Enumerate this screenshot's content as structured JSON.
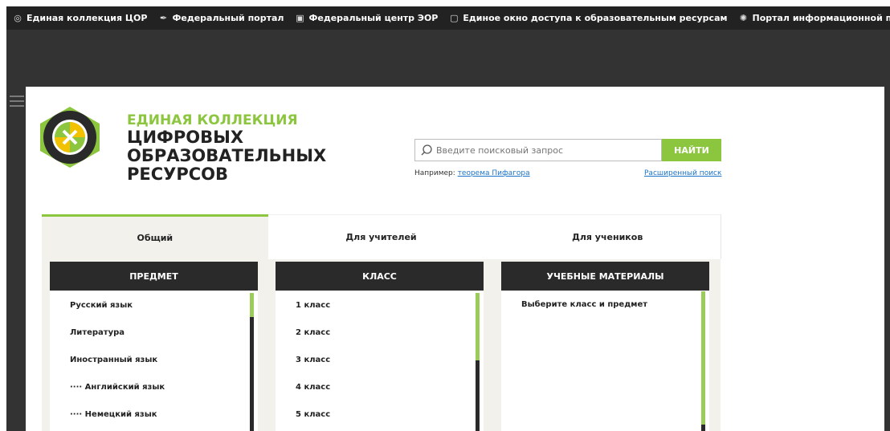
{
  "topnav": [
    {
      "label": "Единая коллекция ЦОР",
      "icon": "collection-icon"
    },
    {
      "label": "Федеральный портал",
      "icon": "feather-icon"
    },
    {
      "label": "Федеральный центр ЭОР",
      "icon": "book-icon"
    },
    {
      "label": "Единое окно доступа к образовательным ресурсам",
      "icon": "window-icon"
    },
    {
      "label": "Портал информационной поддержки ЕГЭ",
      "icon": "globe-icon"
    }
  ],
  "brand": {
    "line1": "ЕДИНАЯ КОЛЛЕКЦИЯ",
    "line2": "ЦИФРОВЫХ",
    "line3": "ОБРАЗОВАТЕЛЬНЫХ",
    "line4": "РЕСУРСОВ"
  },
  "search": {
    "placeholder": "Введите поисковый запрос",
    "button": "НАЙТИ",
    "example_prefix": "Например: ",
    "example_link": "теорема Пифагора",
    "advanced": "Расширенный поиск"
  },
  "tabs": [
    "Общий",
    "Для учителей",
    "Для учеников"
  ],
  "panels": {
    "subject": {
      "title": "ПРЕДМЕТ",
      "items": [
        "Русский язык",
        "Литература",
        "Иностранный язык",
        "···· Английский язык",
        "···· Немецкий язык"
      ]
    },
    "grade": {
      "title": "КЛАСС",
      "items": [
        "1 класс",
        "2 класс",
        "3 класс",
        "4 класс",
        "5 класс"
      ]
    },
    "materials": {
      "title": "УЧЕБНЫЕ МАТЕРИАЛЫ",
      "message": "Выберите класс и предмет"
    }
  },
  "colors": {
    "accent": "#8cc63f",
    "topbar": "#222222",
    "band": "#333333",
    "panel_header": "#2a2a2a",
    "link": "#1a73c8"
  }
}
